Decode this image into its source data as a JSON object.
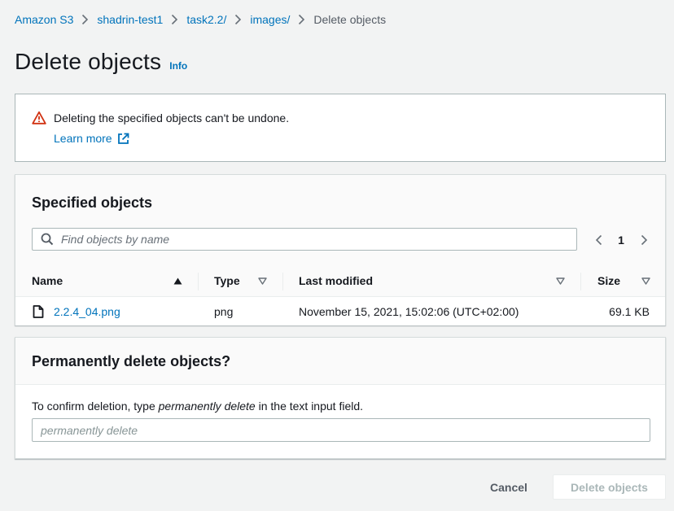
{
  "breadcrumb": {
    "items": [
      "Amazon S3",
      "shadrin-test1",
      "task2.2/",
      "images/"
    ],
    "current": "Delete objects"
  },
  "page": {
    "title": "Delete objects",
    "info_label": "Info"
  },
  "alert": {
    "message": "Deleting the specified objects can't be undone.",
    "learn_more": "Learn more",
    "icon": "warning-icon",
    "icon_color": "#d13212"
  },
  "objects": {
    "title": "Specified objects",
    "search_placeholder": "Find objects by name",
    "search_value": "",
    "page_number": "1",
    "columns": [
      "Name",
      "Type",
      "Last modified",
      "Size"
    ],
    "rows": [
      {
        "name": "2.2.4_04.png",
        "type": "png",
        "last_modified": "November 15, 2021, 15:02:06 (UTC+02:00)",
        "size": "69.1 KB"
      }
    ]
  },
  "permanent": {
    "title": "Permanently delete objects?",
    "desc_prefix": "To confirm deletion, type ",
    "desc_phrase": "permanently delete",
    "desc_suffix": " in the text input field.",
    "input_placeholder": "permanently delete",
    "input_value": ""
  },
  "actions": {
    "cancel": "Cancel",
    "delete": "Delete objects",
    "delete_enabled": false
  },
  "colors": {
    "link": "#0073bb",
    "text": "#16191f",
    "background": "#f2f3f3",
    "disabled": "#aab7b8"
  }
}
